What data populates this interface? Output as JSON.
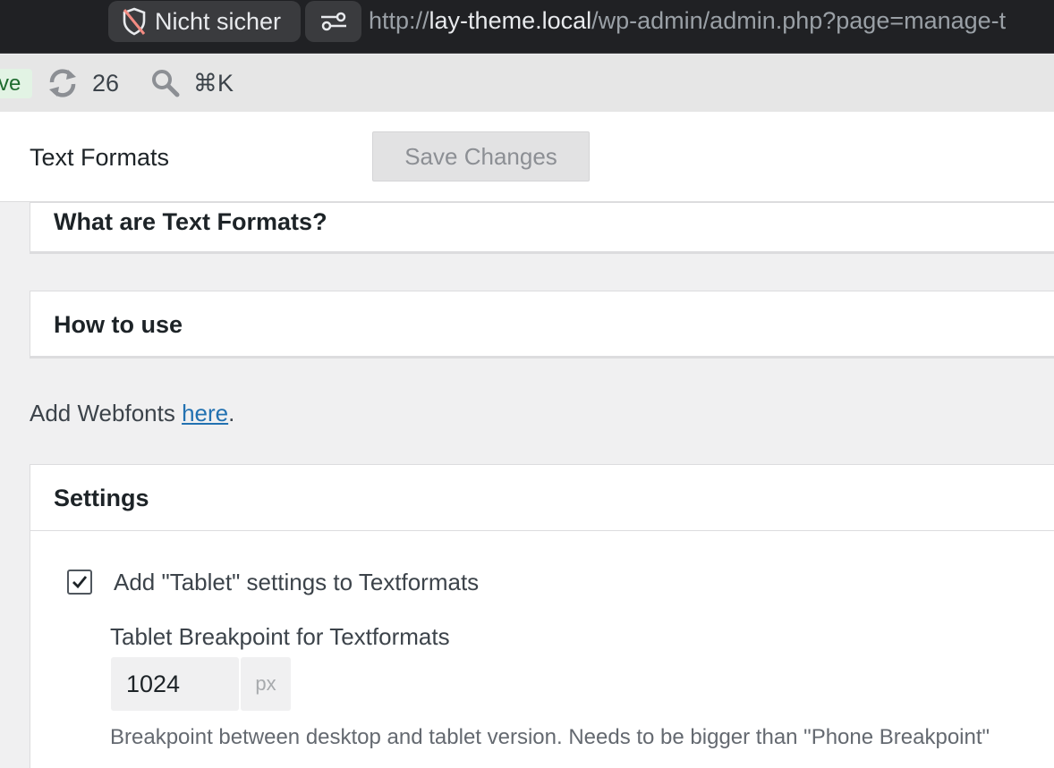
{
  "browser": {
    "security_label": "Nicht sicher",
    "url_scheme": "http://",
    "url_host": "lay-theme.local",
    "url_path": "/wp-admin/admin.php?page=manage-t"
  },
  "admin_bar": {
    "live_badge": "ve",
    "sync_count": "26",
    "search_shortcut": "⌘K"
  },
  "header": {
    "title": "Text Formats",
    "save_label": "Save Changes"
  },
  "panels": {
    "what": "What are Text Formats?",
    "how": "How to use"
  },
  "webfonts": {
    "prefix": "Add Webfonts ",
    "link": "here",
    "suffix": "."
  },
  "settings": {
    "title": "Settings",
    "tablet_checkbox_label": "Add \"Tablet\" settings to Textformats",
    "tablet_checked": true,
    "breakpoint_label": "Tablet Breakpoint for Textformats",
    "breakpoint_value": "1024",
    "breakpoint_unit": "px",
    "breakpoint_help": "Breakpoint between desktop and tablet version. Needs to be bigger than \"Phone Breakpoint\""
  }
}
